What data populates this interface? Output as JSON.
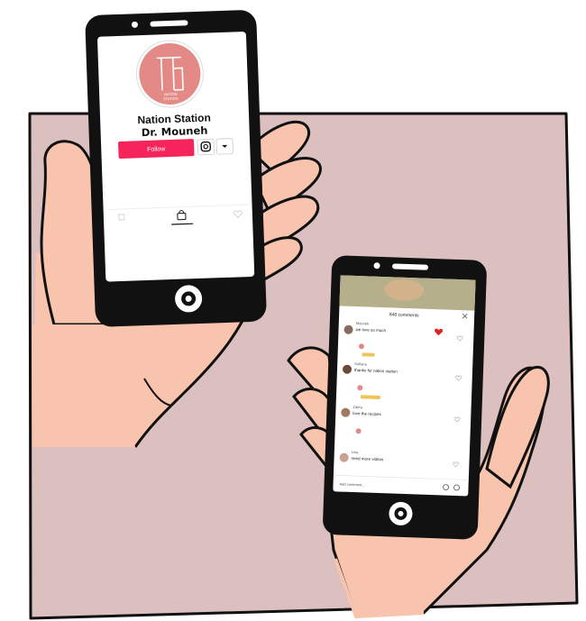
{
  "colors": {
    "background_panel": "#dcbfbf",
    "skin": "#f8c4ae",
    "phone_body": "#111111",
    "screen": "#ffffff",
    "avatar_pink": "#e38a86",
    "follow_button": "#f5245a"
  },
  "profile_phone": {
    "account_name": "Nation Station",
    "display_name": "Dr. Mouneh",
    "follow_label": "Follow",
    "logo_line1": "NATION",
    "logo_line2": "STATION",
    "icons": [
      "instagram-icon",
      "dropdown-arrow-icon",
      "grid-icon",
      "shop-bag-icon",
      "heart-icon"
    ]
  },
  "comments_phone": {
    "header": "848 comments",
    "input_placeholder": "Add comment...",
    "comments": [
      {
        "user": "Mouneh",
        "text": "we love so much"
      },
      {
        "user": "Sufiana",
        "text": "thanks for nation station"
      },
      {
        "user": "Zahra",
        "text": "love the recipes"
      },
      {
        "user": "Lina",
        "text": "need more videos"
      }
    ],
    "icons": [
      "close-icon",
      "heart-icon",
      "mention-icon",
      "emoji-icon"
    ]
  }
}
